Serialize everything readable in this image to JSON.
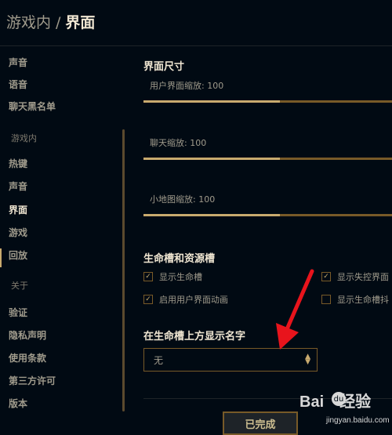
{
  "header": {
    "parent": "游戏内",
    "separator": "/",
    "current": "界面"
  },
  "sidebar": {
    "items": [
      "声音",
      "语音",
      "聊天黑名单"
    ],
    "heading_ingame": "游戏内",
    "ingame_items": [
      "热键",
      "声音",
      "界面",
      "游戏",
      "回放"
    ],
    "heading_about": "关于",
    "about_items": [
      "验证",
      "隐私声明",
      "使用条款",
      "第三方许可",
      "版本"
    ]
  },
  "main": {
    "size_section": {
      "title": "界面尺寸",
      "sliders": [
        {
          "label": "用户界面缩放: 100",
          "value": 100
        },
        {
          "label": "聊天缩放: 100",
          "value": 100
        },
        {
          "label": "小地图缩放: 100",
          "value": 100
        }
      ]
    },
    "health_section": {
      "title": "生命槽和资源槽",
      "options": [
        {
          "label": "显示生命槽",
          "checked": true
        },
        {
          "label": "显示失控界面",
          "checked": true
        },
        {
          "label": "启用用户界面动画",
          "checked": true
        },
        {
          "label": "显示生命槽抖",
          "checked": false
        }
      ]
    },
    "names_section": {
      "title": "在生命槽上方显示名字",
      "select_value": "无"
    }
  },
  "footer": {
    "done_label": "已完成"
  },
  "watermark": {
    "logo_left": "Bai",
    "logo_paw": "du",
    "logo_right": "经验",
    "url": "jingyan.baidu.com"
  },
  "colors": {
    "background": "#010a13",
    "gold": "#c8aa6e",
    "gold_dark": "#785a28",
    "text": "#a09b8c",
    "text_bright": "#f0e6d2",
    "arrow": "#e8141c"
  }
}
